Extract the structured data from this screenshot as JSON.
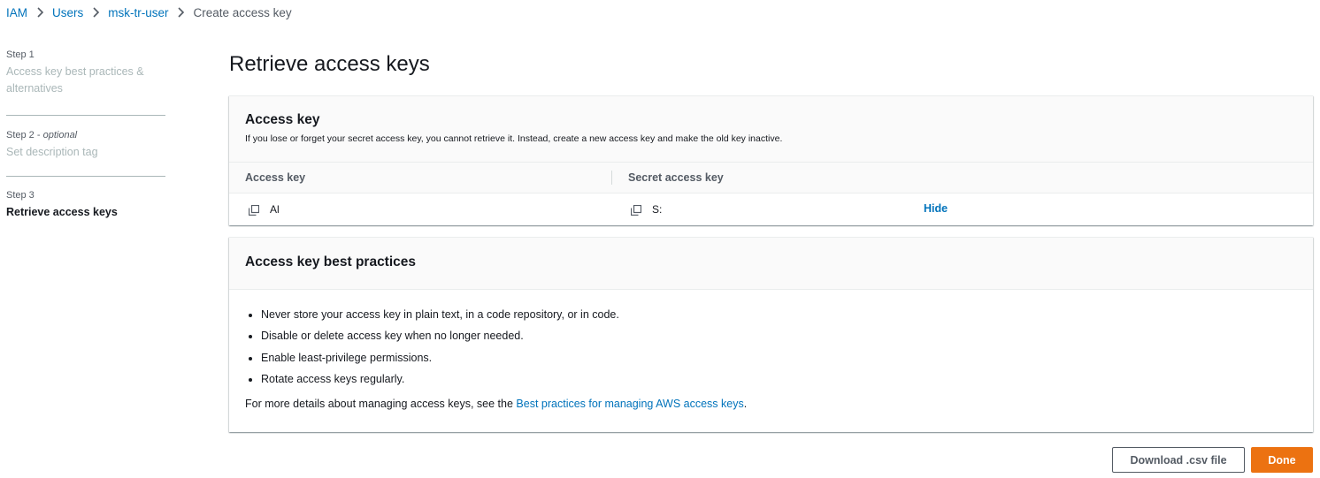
{
  "breadcrumb": {
    "items": [
      {
        "label": "IAM"
      },
      {
        "label": "Users"
      },
      {
        "label": "msk-tr-user"
      },
      {
        "label": "Create access key"
      }
    ]
  },
  "steps": [
    {
      "number": "Step 1",
      "optional": "",
      "title": "Access key best practices & alternatives"
    },
    {
      "number": "Step 2 -",
      "optional": "optional",
      "title": "Set description tag"
    },
    {
      "number": "Step 3",
      "optional": "",
      "title": "Retrieve access keys"
    }
  ],
  "page": {
    "title": "Retrieve access keys"
  },
  "access_key_card": {
    "title": "Access key",
    "description": "If you lose or forget your secret access key, you cannot retrieve it. Instead, create a new access key and make the old key inactive.",
    "columns": [
      "Access key",
      "Secret access key"
    ],
    "row": {
      "access_key_value": "Al",
      "secret_key_value": "S:",
      "hide_label": "Hide"
    }
  },
  "best_practices_card": {
    "title": "Access key best practices",
    "items": [
      "Never store your access key in plain text, in a code repository, or in code.",
      "Disable or delete access key when no longer needed.",
      "Enable least-privilege permissions.",
      "Rotate access keys regularly."
    ],
    "footer_prefix": "For more details about managing access keys, see the ",
    "footer_link": "Best practices for managing AWS access keys",
    "footer_suffix": "."
  },
  "actions": {
    "download_label": "Download .csv file",
    "done_label": "Done"
  },
  "colors": {
    "link": "#0073bb",
    "primary_button": "#ec7211",
    "muted_text": "#aab7b8"
  }
}
